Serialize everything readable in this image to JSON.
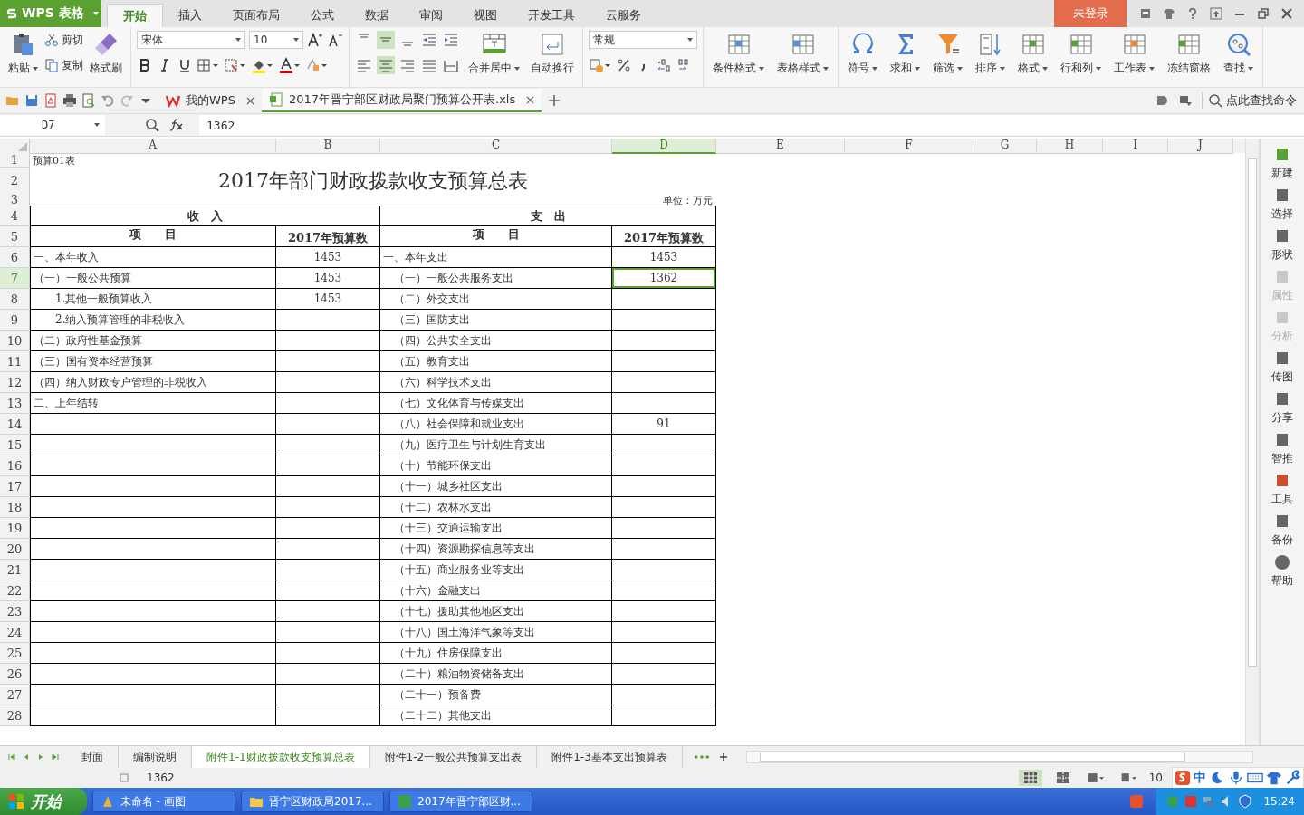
{
  "app": {
    "logo": "WPS 表格"
  },
  "ribbon_tabs": [
    {
      "label": "开始",
      "selected": true
    },
    {
      "label": "插入",
      "selected": false
    },
    {
      "label": "页面布局",
      "selected": false
    },
    {
      "label": "公式",
      "selected": false
    },
    {
      "label": "数据",
      "selected": false
    },
    {
      "label": "审阅",
      "selected": false
    },
    {
      "label": "视图",
      "selected": false
    },
    {
      "label": "开发工具",
      "selected": false
    },
    {
      "label": "云服务",
      "selected": false
    }
  ],
  "login": "未登录",
  "clipboard": {
    "paste": "粘贴",
    "cut": "剪切",
    "copy": "复制",
    "format_painter": "格式刷"
  },
  "font": {
    "family": "宋体",
    "size": "10"
  },
  "vertical_align": [
    {
      "selected": false
    },
    {
      "selected": true
    },
    {
      "selected": false
    }
  ],
  "horizontal_align": [
    {
      "selected": false
    },
    {
      "selected": true
    },
    {
      "selected": false
    },
    {
      "selected": false
    },
    {
      "selected": false
    }
  ],
  "alignment": {
    "merge": "合并居中",
    "wrap": "自动换行"
  },
  "number_format": "常规",
  "tool_groups": [
    [
      {
        "label": "条件格式",
        "dropdown": true
      },
      {
        "label": "表格样式",
        "dropdown": true
      }
    ],
    [
      {
        "label": "符号",
        "dropdown": true
      },
      {
        "label": "求和",
        "dropdown": true
      },
      {
        "label": "筛选",
        "dropdown": true
      },
      {
        "label": "排序",
        "dropdown": true
      },
      {
        "label": "格式",
        "dropdown": true
      },
      {
        "label": "行和列",
        "dropdown": true
      },
      {
        "label": "工作表",
        "dropdown": true
      },
      {
        "label": "冻结窗格",
        "dropdown": false
      },
      {
        "label": "查找",
        "dropdown": true
      }
    ]
  ],
  "doc_tabs": [
    {
      "label": "我的WPS",
      "selected": false
    },
    {
      "label": "2017年晋宁部区财政局聚门预算公开表.xls",
      "selected": true
    }
  ],
  "command_search": "点此查找命令",
  "formula_bar": {
    "cell": "D7",
    "value": "1362"
  },
  "columns": [
    {
      "label": "A",
      "selected": false
    },
    {
      "label": "B",
      "selected": false
    },
    {
      "label": "C",
      "selected": false
    },
    {
      "label": "D",
      "selected": true
    },
    {
      "label": "E",
      "selected": false
    },
    {
      "label": "F",
      "selected": false
    },
    {
      "label": "G",
      "selected": false
    },
    {
      "label": "H",
      "selected": false
    },
    {
      "label": "I",
      "selected": false
    },
    {
      "label": "J",
      "selected": false
    }
  ],
  "rows": [
    {
      "number": "1",
      "selected": false,
      "kind": "note",
      "note": "预算01表"
    },
    {
      "number": "2",
      "selected": false,
      "kind": "title",
      "title": "2017年部门财政拨款收支预算总表"
    },
    {
      "number": "3",
      "selected": false,
      "kind": "unit",
      "unit": "单位：万元"
    },
    {
      "number": "4",
      "selected": false,
      "kind": "section",
      "income": "收　入",
      "expense": "支　出"
    },
    {
      "number": "5",
      "selected": false,
      "kind": "header",
      "income_item": "项　　目",
      "income_amount": "2017年预算数",
      "expense_item": "项　　目",
      "expense_amount": "2017年预算数"
    },
    {
      "number": "6",
      "selected": false,
      "kind": "data",
      "income_item": "一、本年收入",
      "income_amount": "1453",
      "expense_item": "一、本年支出",
      "expense_amount": "1453"
    },
    {
      "number": "7",
      "selected": true,
      "kind": "data",
      "income_item": "（一）一般公共预算",
      "income_amount": "1453",
      "expense_item": "　（一）一般公共服务支出",
      "expense_amount": "1362"
    },
    {
      "number": "8",
      "selected": false,
      "kind": "data",
      "income_item": "　　1.其他一般预算收入",
      "income_amount": "1453",
      "expense_item": "　（二）外交支出"
    },
    {
      "number": "9",
      "selected": false,
      "kind": "data",
      "income_item": "　　2.纳入预算管理的非税收入",
      "expense_item": "　（三）国防支出"
    },
    {
      "number": "10",
      "selected": false,
      "kind": "data",
      "income_item": "（二）政府性基金预算",
      "expense_item": "　（四）公共安全支出"
    },
    {
      "number": "11",
      "selected": false,
      "kind": "data",
      "income_item": "（三）国有资本经营预算",
      "expense_item": "　（五）教育支出"
    },
    {
      "number": "12",
      "selected": false,
      "kind": "data",
      "income_item": "（四）纳入财政专户管理的非税收入",
      "expense_item": "　（六）科学技术支出"
    },
    {
      "number": "13",
      "selected": false,
      "kind": "data",
      "income_item": "二、上年结转",
      "expense_item": "　（七）文化体育与传媒支出"
    },
    {
      "number": "14",
      "selected": false,
      "kind": "data",
      "expense_item": "　（八）社会保障和就业支出",
      "expense_amount": "91"
    },
    {
      "number": "15",
      "selected": false,
      "kind": "data",
      "expense_item": "　（九）医疗卫生与计划生育支出"
    },
    {
      "number": "16",
      "selected": false,
      "kind": "data",
      "expense_item": "　（十）节能环保支出"
    },
    {
      "number": "17",
      "selected": false,
      "kind": "data",
      "expense_item": "　（十一）城乡社区支出"
    },
    {
      "number": "18",
      "selected": false,
      "kind": "data",
      "expense_item": "　（十二）农林水支出"
    },
    {
      "number": "19",
      "selected": false,
      "kind": "data",
      "expense_item": "　（十三）交通运输支出"
    },
    {
      "number": "20",
      "selected": false,
      "kind": "data",
      "expense_item": "　（十四）资源勘探信息等支出"
    },
    {
      "number": "21",
      "selected": false,
      "kind": "data",
      "expense_item": "　（十五）商业服务业等支出"
    },
    {
      "number": "22",
      "selected": false,
      "kind": "data",
      "expense_item": "　（十六）金融支出"
    },
    {
      "number": "23",
      "selected": false,
      "kind": "data",
      "expense_item": "　（十七）援助其他地区支出"
    },
    {
      "number": "24",
      "selected": false,
      "kind": "data",
      "expense_item": "　（十八）国土海洋气象等支出"
    },
    {
      "number": "25",
      "selected": false,
      "kind": "data",
      "expense_item": "　（十九）住房保障支出"
    },
    {
      "number": "26",
      "selected": false,
      "kind": "data",
      "expense_item": "　（二十）粮油物资储备支出"
    },
    {
      "number": "27",
      "selected": false,
      "kind": "data",
      "expense_item": "　（二十一）预备费"
    },
    {
      "number": "28",
      "selected": false,
      "kind": "data",
      "expense_item": "　（二十二）其他支出"
    }
  ],
  "sidebar": [
    {
      "label": "新建",
      "disabled": false
    },
    {
      "label": "选择",
      "disabled": false
    },
    {
      "label": "形状",
      "disabled": false
    },
    {
      "label": "属性",
      "disabled": true
    },
    {
      "label": "分析",
      "disabled": true
    },
    {
      "label": "传图",
      "disabled": false
    },
    {
      "label": "分享",
      "disabled": false
    },
    {
      "label": "智推",
      "disabled": false
    },
    {
      "label": "工具",
      "disabled": false
    },
    {
      "label": "备份",
      "disabled": false
    },
    {
      "label": "帮助",
      "disabled": false
    }
  ],
  "sheet_tabs": [
    {
      "label": "封面",
      "selected": false
    },
    {
      "label": "编制说明",
      "selected": false
    },
    {
      "label": "附件1-1财政拨款收支预算总表",
      "selected": true
    },
    {
      "label": "附件1-2一般公共预算支出表",
      "selected": false
    },
    {
      "label": "附件1-3基本支出预算表",
      "selected": false
    }
  ],
  "status": {
    "value": "1362",
    "zoom": "10",
    "ime": "中"
  },
  "taskbar": {
    "start": "开始",
    "items": [
      "未命名 - 画图",
      "晋宁区财政局2017...",
      "2017年晋宁部区财..."
    ],
    "clock": "15:24"
  }
}
